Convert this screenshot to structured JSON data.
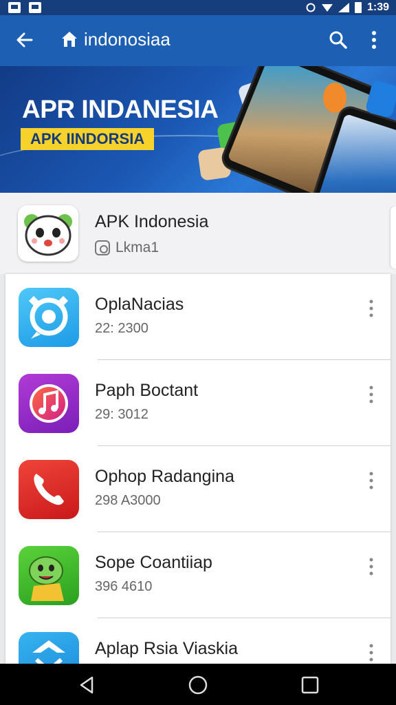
{
  "status_bar": {
    "time": "1:39"
  },
  "app_bar": {
    "title": "indonosiaa"
  },
  "banner": {
    "headline": "APR INDANESIA",
    "tagline": "APK IINDORSIA"
  },
  "profile": {
    "name": "APK Indonesia",
    "subtitle": "Lkma1"
  },
  "apps": [
    {
      "name": "OplaNacias",
      "meta": "22: 2300",
      "icon": "chat-bubble-icon"
    },
    {
      "name": "Paph Boctant",
      "meta": "29: 3012",
      "icon": "music-note-icon"
    },
    {
      "name": "Ophop Radangina",
      "meta": "298 A3000",
      "icon": "phone-icon"
    },
    {
      "name": "Sope Coantiiap",
      "meta": "396 4610",
      "icon": "cartoon-character-icon"
    },
    {
      "name": "Aplap Rsia Viaskia",
      "meta": "",
      "icon": "blue-logo-icon"
    }
  ],
  "colors": {
    "app_bar": "#1c5fb3",
    "status_bar": "#163e7c",
    "tag_yellow": "#f6d22b"
  }
}
